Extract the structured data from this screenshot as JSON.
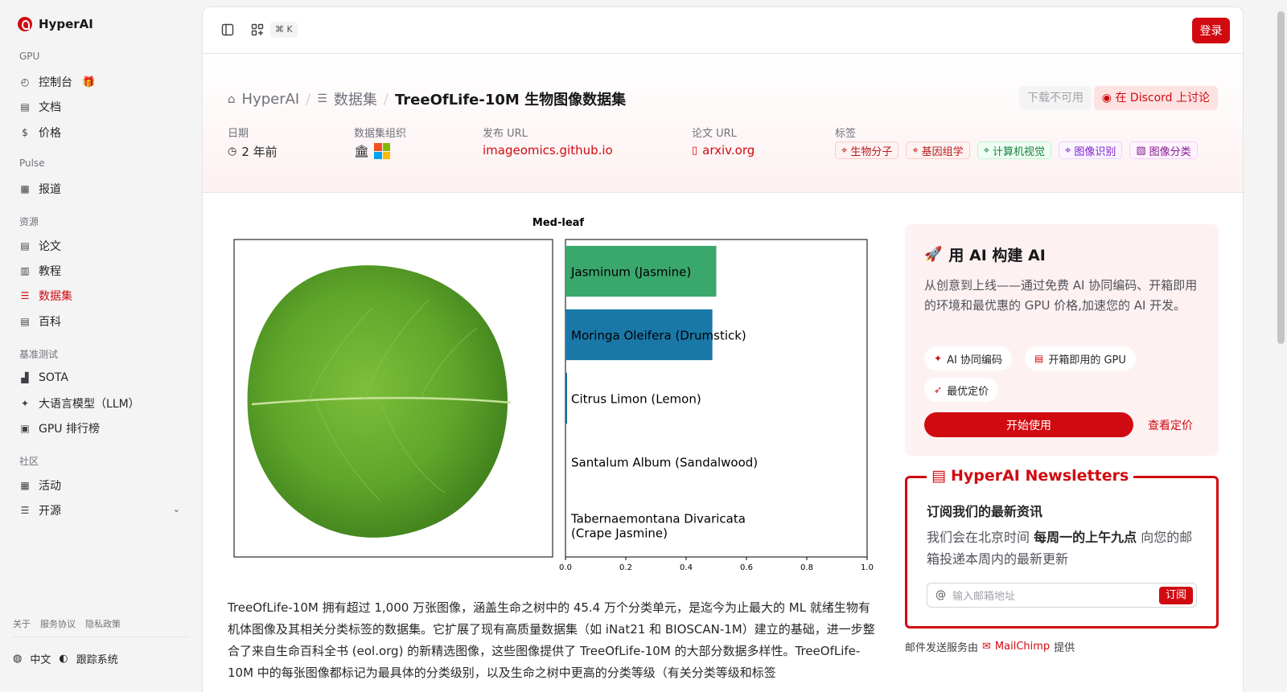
{
  "brand": {
    "name": "HyperAI"
  },
  "sidebar": {
    "sections": [
      {
        "title": "GPU"
      },
      {
        "title": "Pulse"
      },
      {
        "title": "资源"
      },
      {
        "title": "基准测试"
      },
      {
        "title": "社区"
      }
    ],
    "items": [
      {
        "label": "控制台",
        "icon": "gauge-icon"
      },
      {
        "label": "文档",
        "icon": "doc-icon"
      },
      {
        "label": "价格",
        "icon": "dollar-icon"
      },
      {
        "label": "报道",
        "icon": "newspaper-icon"
      },
      {
        "label": "论文",
        "icon": "paper-icon"
      },
      {
        "label": "教程",
        "icon": "book-icon"
      },
      {
        "label": "数据集",
        "icon": "database-icon"
      },
      {
        "label": "百科",
        "icon": "encyclopedia-icon"
      },
      {
        "label": "SOTA",
        "icon": "bar-chart-icon"
      },
      {
        "label": "大语言模型（LLM）",
        "icon": "sparkles-icon"
      },
      {
        "label": "GPU 排行榜",
        "icon": "chip-icon"
      },
      {
        "label": "活动",
        "icon": "calendar-icon"
      },
      {
        "label": "开源",
        "icon": "list-icon"
      }
    ],
    "footer_links": [
      "关于",
      "服务协议",
      "隐私政策"
    ],
    "language": "中文",
    "tracking": "跟踪系统"
  },
  "topbar": {
    "shortcut": "⌘ K",
    "login": "登录"
  },
  "hero": {
    "breadcrumb": [
      "HyperAI",
      "数据集",
      "TreeOfLife-10M 生物图像数据集"
    ],
    "download_btn": "下载不可用",
    "discord_btn": "在 Discord 上讨论",
    "meta": {
      "date_label": "日期",
      "date_value": "2 年前",
      "org_label": "数据集组织",
      "release_label": "发布 URL",
      "release_value": "imageomics.github.io",
      "paper_label": "论文 URL",
      "paper_value": "arxiv.org",
      "tags_label": "标签"
    },
    "tags": [
      {
        "label": "生物分子",
        "color": "#b91c1c",
        "bg": "#fef2f2",
        "border": "#fecaca"
      },
      {
        "label": "基因组学",
        "color": "#b91c1c",
        "bg": "#fef2f2",
        "border": "#fecaca"
      },
      {
        "label": "计算机视觉",
        "color": "#15803d",
        "bg": "#f0fdf4",
        "border": "#bbf7d0"
      },
      {
        "label": "图像识别",
        "color": "#7e22ce",
        "bg": "#faf5ff",
        "border": "#e9d5ff"
      },
      {
        "label": "图像分类",
        "color": "#86198f",
        "bg": "#fdf4ff",
        "border": "#f5d0fe"
      }
    ]
  },
  "chart_data": {
    "type": "bar",
    "title": "Med-leaf",
    "categories": [
      "Jasminum (Jasmine)",
      "Moringa Oleifera (Drumstick)",
      "Citrus Limon (Lemon)",
      "Santalum Album (Sandalwood)",
      "Tabernaemontana Divaricata (Crape Jasmine)"
    ],
    "category_lines": [
      [
        "Jasminum (Jasmine)"
      ],
      [
        "Moringa Oleifera (Drumstick)"
      ],
      [
        "Citrus Limon (Lemon)"
      ],
      [
        "Santalum Album (Sandalwood)"
      ],
      [
        "Tabernaemontana Divaricata",
        "(Crape Jasmine)"
      ]
    ],
    "values": [
      0.5,
      0.487,
      0.005,
      0.0,
      0.0
    ],
    "colors": [
      "#3aa76d",
      "#1a78a8",
      "#1a6e99",
      "#1a6e99",
      "#1a6e99"
    ],
    "xlim": [
      0,
      1.0
    ],
    "xticks": [
      "0.0",
      "0.2",
      "0.4",
      "0.6",
      "0.8",
      "1.0"
    ],
    "orientation": "horizontal"
  },
  "article": {
    "text": "TreeOfLife-10M 拥有超过 1,000 万张图像，涵盖生命之树中的 45.4 万个分类单元，是迄今为止最大的 ML 就绪生物有机体图像及其相关分类标签的数据集。它扩展了现有高质量数据集（如 iNat21 和 BIOSCAN-1M）建立的基础，进一步整合了来自生命百科全书 (eol.org) 的新精选图像，这些图像提供了 TreeOfLife-10M 的大部分数据多样性。TreeOfLife-10M 中的每张图像都标记为最具体的分类级别，以及生命之树中更高的分类等级（有关分类等级和标签"
  },
  "promo": {
    "title": "用 AI 构建 AI",
    "desc": "从创意到上线——通过免费 AI 协同编码、开箱即用的环境和最优惠的 GPU 价格,加速您的 AI 开发。",
    "pills": [
      "AI 协同编码",
      "开箱即用的 GPU",
      "最优定价"
    ],
    "start": "开始使用",
    "pricing": "查看定价"
  },
  "newsletter": {
    "title": "HyperAI Newsletters",
    "subtitle": "订阅我们的最新资讯",
    "desc_pre": "我们会在北京时间 ",
    "desc_bold": "每周一的上午九点",
    "desc_post": " 向您的邮箱投递本周内的最新更新",
    "placeholder": "输入邮箱地址",
    "subscribe": "订阅",
    "mail_by_pre": "邮件发送服务由",
    "mail_by_brand": "MailChimp",
    "mail_by_post": "提供"
  }
}
